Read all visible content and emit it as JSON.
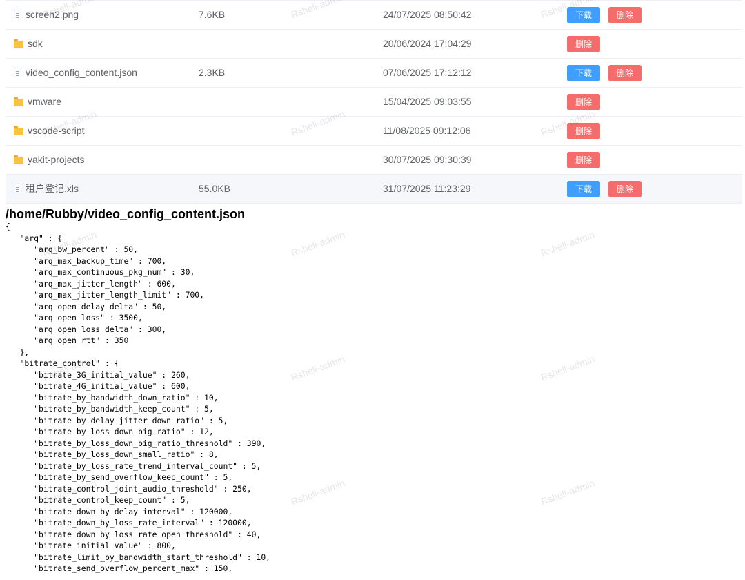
{
  "files": [
    {
      "name": "screen2.png",
      "type": "file",
      "size": "7.6KB",
      "date": "24/07/2025 08:50:42",
      "download": true
    },
    {
      "name": "sdk",
      "type": "folder",
      "size": "",
      "date": "20/06/2024 17:04:29",
      "download": false
    },
    {
      "name": "video_config_content.json",
      "type": "file",
      "size": "2.3KB",
      "date": "07/06/2025 17:12:12",
      "download": true
    },
    {
      "name": "vmware",
      "type": "folder",
      "size": "",
      "date": "15/04/2025 09:03:55",
      "download": false
    },
    {
      "name": "vscode-script",
      "type": "folder",
      "size": "",
      "date": "11/08/2025 09:12:06",
      "download": false
    },
    {
      "name": "yakit-projects",
      "type": "folder",
      "size": "",
      "date": "30/07/2025 09:30:39",
      "download": false
    },
    {
      "name": "租户登记.xls",
      "type": "file",
      "size": "55.0KB",
      "date": "31/07/2025 11:23:29",
      "download": true,
      "hover": true
    }
  ],
  "labels": {
    "download": "下载",
    "delete": "删除"
  },
  "viewer": {
    "path": "/home/Rubby/video_config_content.json",
    "lines": [
      "{",
      "   \"arq\" : {",
      "      \"arq_bw_percent\" : 50,",
      "      \"arq_max_backup_time\" : 700,",
      "      \"arq_max_continuous_pkg_num\" : 30,",
      "      \"arq_max_jitter_length\" : 600,",
      "      \"arq_max_jitter_length_limit\" : 700,",
      "      \"arq_open_delay_delta\" : 50,",
      "      \"arq_open_loss\" : 3500,",
      "      \"arq_open_loss_delta\" : 300,",
      "      \"arq_open_rtt\" : 350",
      "   },",
      "   \"bitrate_control\" : {",
      "      \"bitrate_3G_initial_value\" : 260,",
      "      \"bitrate_4G_initial_value\" : 600,",
      "      \"bitrate_by_bandwidth_down_ratio\" : 10,",
      "      \"bitrate_by_bandwidth_keep_count\" : 5,",
      "      \"bitrate_by_delay_jitter_down_ratio\" : 5,",
      "      \"bitrate_by_loss_down_big_ratio\" : 12,",
      "      \"bitrate_by_loss_down_big_ratio_threshold\" : 390,",
      "      \"bitrate_by_loss_down_small_ratio\" : 8,",
      "      \"bitrate_by_loss_rate_trend_interval_count\" : 5,",
      "      \"bitrate_by_send_overflow_keep_count\" : 5,",
      "      \"bitrate_control_joint_audio_threshold\" : 250,",
      "      \"bitrate_control_keep_count\" : 5,",
      "      \"bitrate_down_by_delay_interval\" : 120000,",
      "      \"bitrate_down_by_loss_rate_interval\" : 120000,",
      "      \"bitrate_down_by_loss_rate_open_threshold\" : 40,",
      "      \"bitrate_initial_value\" : 800,",
      "      \"bitrate_limit_by_bandwidth_start_threshold\" : 10,",
      "      \"bitrate_send_overflow_percent_max\" : 150,"
    ]
  },
  "watermark": "Rshell-admin"
}
